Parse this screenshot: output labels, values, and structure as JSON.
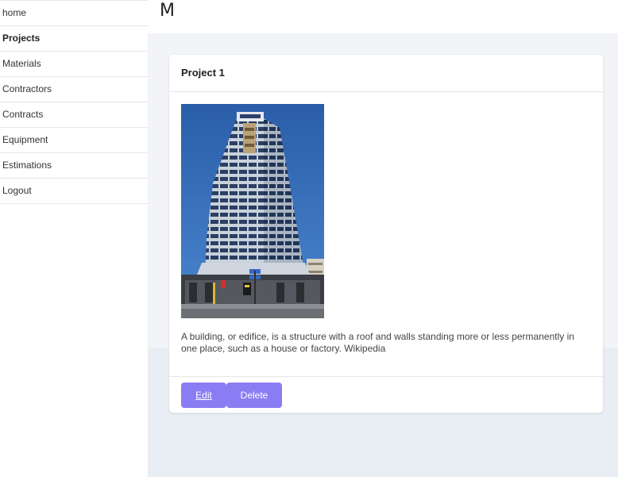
{
  "sidebar": {
    "items": [
      {
        "label": "home"
      },
      {
        "label": "Projects"
      },
      {
        "label": "Materials"
      },
      {
        "label": "Contractors"
      },
      {
        "label": "Contracts"
      },
      {
        "label": "Equipment"
      },
      {
        "label": "Estimations"
      },
      {
        "label": "Logout"
      }
    ]
  },
  "header": {
    "title": "M"
  },
  "card": {
    "title": "Project 1",
    "description": "A building, or edifice, is a structure with a roof and walls standing more or less permanently in one place, such as a house or factory. Wikipedia",
    "edit_label": "Edit",
    "delete_label": "Delete"
  },
  "colors": {
    "button": "#8a7df3",
    "page_background": "#e9edf4",
    "sky": "#2f68b3"
  }
}
